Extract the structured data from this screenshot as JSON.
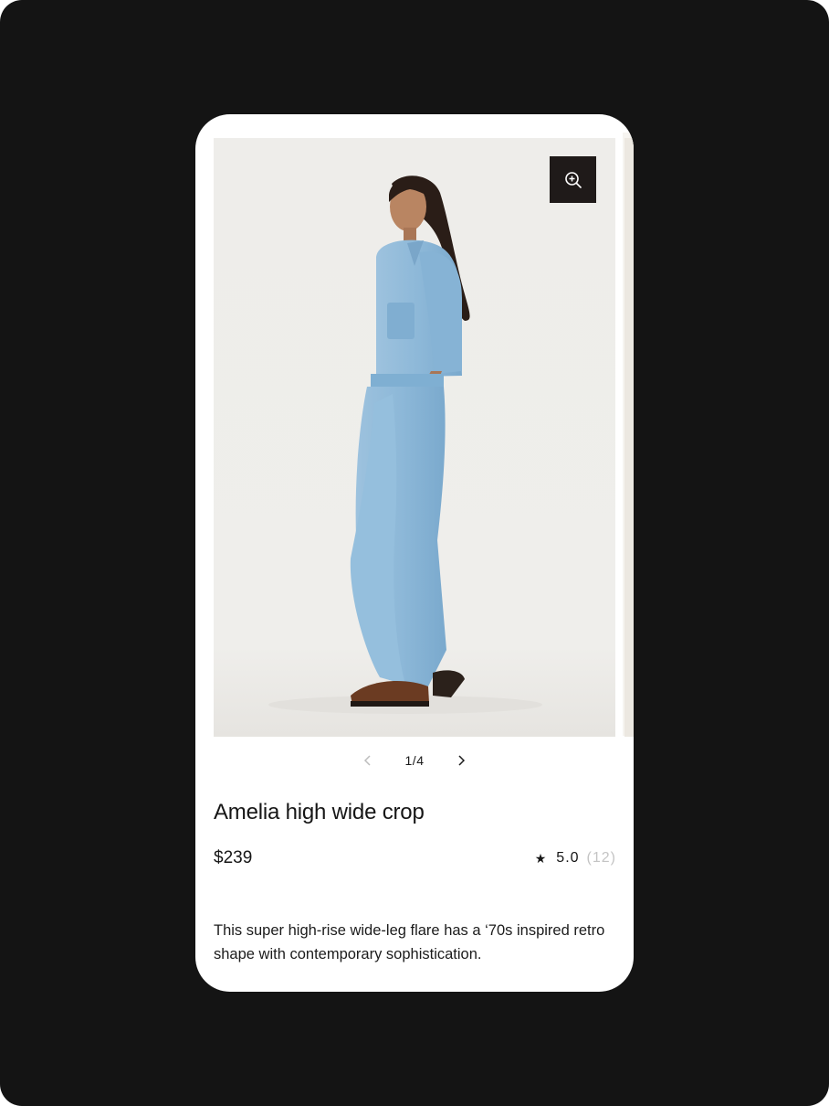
{
  "gallery": {
    "current": "1",
    "total": "4",
    "separator": "/",
    "zoom_icon": "zoom-in-icon",
    "prev_icon": "chevron-left-icon",
    "next_icon": "chevron-right-icon"
  },
  "product": {
    "name": "Amelia high wide crop",
    "price": "$239",
    "rating": "5.0",
    "review_count": "(12)",
    "description": "This super high-rise wide-leg flare has a ‘70s inspired retro shape with contemporary sophistication."
  },
  "colors": {
    "background": "#141414",
    "card": "#ffffff",
    "zoom_button": "#1f1a19",
    "denim": "#8fb9d8",
    "muted_text": "#c4c4c4"
  }
}
